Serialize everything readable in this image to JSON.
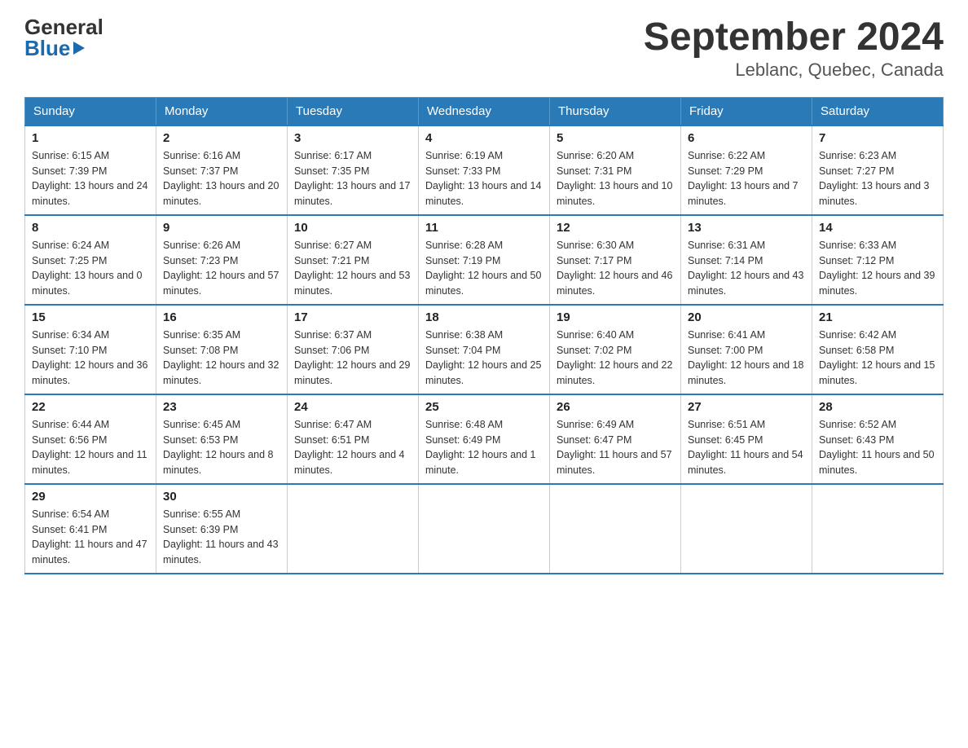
{
  "header": {
    "logo_line1": "General",
    "logo_line2": "Blue",
    "month_year": "September 2024",
    "location": "Leblanc, Quebec, Canada"
  },
  "days_of_week": [
    "Sunday",
    "Monday",
    "Tuesday",
    "Wednesday",
    "Thursday",
    "Friday",
    "Saturday"
  ],
  "weeks": [
    [
      {
        "day": "1",
        "sunrise": "6:15 AM",
        "sunset": "7:39 PM",
        "daylight": "13 hours and 24 minutes."
      },
      {
        "day": "2",
        "sunrise": "6:16 AM",
        "sunset": "7:37 PM",
        "daylight": "13 hours and 20 minutes."
      },
      {
        "day": "3",
        "sunrise": "6:17 AM",
        "sunset": "7:35 PM",
        "daylight": "13 hours and 17 minutes."
      },
      {
        "day": "4",
        "sunrise": "6:19 AM",
        "sunset": "7:33 PM",
        "daylight": "13 hours and 14 minutes."
      },
      {
        "day": "5",
        "sunrise": "6:20 AM",
        "sunset": "7:31 PM",
        "daylight": "13 hours and 10 minutes."
      },
      {
        "day": "6",
        "sunrise": "6:22 AM",
        "sunset": "7:29 PM",
        "daylight": "13 hours and 7 minutes."
      },
      {
        "day": "7",
        "sunrise": "6:23 AM",
        "sunset": "7:27 PM",
        "daylight": "13 hours and 3 minutes."
      }
    ],
    [
      {
        "day": "8",
        "sunrise": "6:24 AM",
        "sunset": "7:25 PM",
        "daylight": "13 hours and 0 minutes."
      },
      {
        "day": "9",
        "sunrise": "6:26 AM",
        "sunset": "7:23 PM",
        "daylight": "12 hours and 57 minutes."
      },
      {
        "day": "10",
        "sunrise": "6:27 AM",
        "sunset": "7:21 PM",
        "daylight": "12 hours and 53 minutes."
      },
      {
        "day": "11",
        "sunrise": "6:28 AM",
        "sunset": "7:19 PM",
        "daylight": "12 hours and 50 minutes."
      },
      {
        "day": "12",
        "sunrise": "6:30 AM",
        "sunset": "7:17 PM",
        "daylight": "12 hours and 46 minutes."
      },
      {
        "day": "13",
        "sunrise": "6:31 AM",
        "sunset": "7:14 PM",
        "daylight": "12 hours and 43 minutes."
      },
      {
        "day": "14",
        "sunrise": "6:33 AM",
        "sunset": "7:12 PM",
        "daylight": "12 hours and 39 minutes."
      }
    ],
    [
      {
        "day": "15",
        "sunrise": "6:34 AM",
        "sunset": "7:10 PM",
        "daylight": "12 hours and 36 minutes."
      },
      {
        "day": "16",
        "sunrise": "6:35 AM",
        "sunset": "7:08 PM",
        "daylight": "12 hours and 32 minutes."
      },
      {
        "day": "17",
        "sunrise": "6:37 AM",
        "sunset": "7:06 PM",
        "daylight": "12 hours and 29 minutes."
      },
      {
        "day": "18",
        "sunrise": "6:38 AM",
        "sunset": "7:04 PM",
        "daylight": "12 hours and 25 minutes."
      },
      {
        "day": "19",
        "sunrise": "6:40 AM",
        "sunset": "7:02 PM",
        "daylight": "12 hours and 22 minutes."
      },
      {
        "day": "20",
        "sunrise": "6:41 AM",
        "sunset": "7:00 PM",
        "daylight": "12 hours and 18 minutes."
      },
      {
        "day": "21",
        "sunrise": "6:42 AM",
        "sunset": "6:58 PM",
        "daylight": "12 hours and 15 minutes."
      }
    ],
    [
      {
        "day": "22",
        "sunrise": "6:44 AM",
        "sunset": "6:56 PM",
        "daylight": "12 hours and 11 minutes."
      },
      {
        "day": "23",
        "sunrise": "6:45 AM",
        "sunset": "6:53 PM",
        "daylight": "12 hours and 8 minutes."
      },
      {
        "day": "24",
        "sunrise": "6:47 AM",
        "sunset": "6:51 PM",
        "daylight": "12 hours and 4 minutes."
      },
      {
        "day": "25",
        "sunrise": "6:48 AM",
        "sunset": "6:49 PM",
        "daylight": "12 hours and 1 minute."
      },
      {
        "day": "26",
        "sunrise": "6:49 AM",
        "sunset": "6:47 PM",
        "daylight": "11 hours and 57 minutes."
      },
      {
        "day": "27",
        "sunrise": "6:51 AM",
        "sunset": "6:45 PM",
        "daylight": "11 hours and 54 minutes."
      },
      {
        "day": "28",
        "sunrise": "6:52 AM",
        "sunset": "6:43 PM",
        "daylight": "11 hours and 50 minutes."
      }
    ],
    [
      {
        "day": "29",
        "sunrise": "6:54 AM",
        "sunset": "6:41 PM",
        "daylight": "11 hours and 47 minutes."
      },
      {
        "day": "30",
        "sunrise": "6:55 AM",
        "sunset": "6:39 PM",
        "daylight": "11 hours and 43 minutes."
      },
      null,
      null,
      null,
      null,
      null
    ]
  ]
}
